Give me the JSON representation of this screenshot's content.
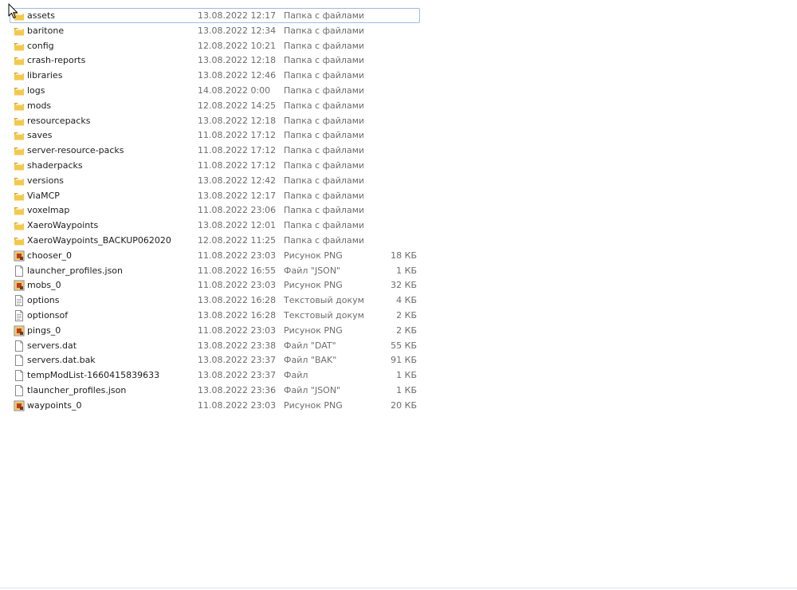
{
  "colors": {
    "folder": "#f2c94c",
    "folder_dark": "#d9a520",
    "png_accent": "#c0392b",
    "text": "#1e1e1e",
    "meta_text": "#6d6d6d",
    "focus_border": "#9bbde0"
  },
  "files": [
    {
      "name": "assets",
      "date": "13.08.2022 12:17",
      "type": "Папка с файлами",
      "size": "",
      "icon": "folder-icon"
    },
    {
      "name": "baritone",
      "date": "13.08.2022 12:34",
      "type": "Папка с файлами",
      "size": "",
      "icon": "folder-icon"
    },
    {
      "name": "config",
      "date": "12.08.2022 10:21",
      "type": "Папка с файлами",
      "size": "",
      "icon": "folder-icon"
    },
    {
      "name": "crash-reports",
      "date": "13.08.2022 12:18",
      "type": "Папка с файлами",
      "size": "",
      "icon": "folder-icon"
    },
    {
      "name": "libraries",
      "date": "13.08.2022 12:46",
      "type": "Папка с файлами",
      "size": "",
      "icon": "folder-icon"
    },
    {
      "name": "logs",
      "date": "14.08.2022 0:00",
      "type": "Папка с файлами",
      "size": "",
      "icon": "folder-icon"
    },
    {
      "name": "mods",
      "date": "12.08.2022 14:25",
      "type": "Папка с файлами",
      "size": "",
      "icon": "folder-icon"
    },
    {
      "name": "resourcepacks",
      "date": "13.08.2022 12:18",
      "type": "Папка с файлами",
      "size": "",
      "icon": "folder-icon"
    },
    {
      "name": "saves",
      "date": "11.08.2022 17:12",
      "type": "Папка с файлами",
      "size": "",
      "icon": "folder-icon"
    },
    {
      "name": "server-resource-packs",
      "date": "11.08.2022 17:12",
      "type": "Папка с файлами",
      "size": "",
      "icon": "folder-icon"
    },
    {
      "name": "shaderpacks",
      "date": "11.08.2022 17:12",
      "type": "Папка с файлами",
      "size": "",
      "icon": "folder-icon"
    },
    {
      "name": "versions",
      "date": "13.08.2022 12:42",
      "type": "Папка с файлами",
      "size": "",
      "icon": "folder-icon"
    },
    {
      "name": "ViaMCP",
      "date": "13.08.2022 12:17",
      "type": "Папка с файлами",
      "size": "",
      "icon": "folder-icon"
    },
    {
      "name": "voxelmap",
      "date": "11.08.2022 23:06",
      "type": "Папка с файлами",
      "size": "",
      "icon": "folder-icon"
    },
    {
      "name": "XaeroWaypoints",
      "date": "13.08.2022 12:01",
      "type": "Папка с файлами",
      "size": "",
      "icon": "folder-icon"
    },
    {
      "name": "XaeroWaypoints_BACKUP062020",
      "date": "12.08.2022 11:25",
      "type": "Папка с файлами",
      "size": "",
      "icon": "folder-icon"
    },
    {
      "name": "chooser_0",
      "date": "11.08.2022 23:03",
      "type": "Рисунок PNG",
      "size": "18 КБ",
      "icon": "png-image-icon"
    },
    {
      "name": "launcher_profiles.json",
      "date": "11.08.2022 16:55",
      "type": "Файл \"JSON\"",
      "size": "1 КБ",
      "icon": "file-icon"
    },
    {
      "name": "mobs_0",
      "date": "11.08.2022 23:03",
      "type": "Рисунок PNG",
      "size": "32 КБ",
      "icon": "png-image-icon"
    },
    {
      "name": "options",
      "date": "13.08.2022 16:28",
      "type": "Текстовый докум...",
      "size": "4 КБ",
      "icon": "text-file-icon"
    },
    {
      "name": "optionsof",
      "date": "13.08.2022 16:28",
      "type": "Текстовый докум...",
      "size": "2 КБ",
      "icon": "text-file-icon"
    },
    {
      "name": "pings_0",
      "date": "11.08.2022 23:03",
      "type": "Рисунок PNG",
      "size": "2 КБ",
      "icon": "png-image-icon"
    },
    {
      "name": "servers.dat",
      "date": "13.08.2022 23:38",
      "type": "Файл \"DAT\"",
      "size": "55 КБ",
      "icon": "file-icon"
    },
    {
      "name": "servers.dat.bak",
      "date": "13.08.2022 23:37",
      "type": "Файл \"BAK\"",
      "size": "91 КБ",
      "icon": "file-icon"
    },
    {
      "name": "tempModList-1660415839633",
      "date": "13.08.2022 23:37",
      "type": "Файл",
      "size": "1 КБ",
      "icon": "file-icon"
    },
    {
      "name": "tlauncher_profiles.json",
      "date": "13.08.2022 23:36",
      "type": "Файл \"JSON\"",
      "size": "1 КБ",
      "icon": "file-icon"
    },
    {
      "name": "waypoints_0",
      "date": "11.08.2022 23:03",
      "type": "Рисунок PNG",
      "size": "20 КБ",
      "icon": "png-image-icon"
    }
  ]
}
